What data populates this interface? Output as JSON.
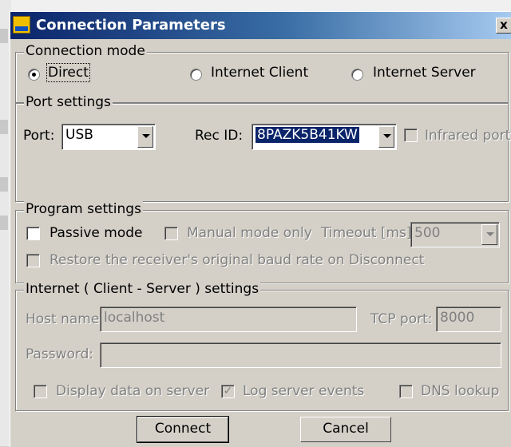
{
  "dialog": {
    "title": "Connection Parameters",
    "close_label": "x"
  },
  "connection_mode": {
    "legend": "Connection mode",
    "options": [
      {
        "label": "Direct",
        "selected": true
      },
      {
        "label": "Internet Client",
        "selected": false
      },
      {
        "label": "Internet Server",
        "selected": false
      }
    ]
  },
  "port_settings": {
    "legend": "Port settings",
    "port_label": "Port:",
    "port_value": "USB",
    "rec_id_label": "Rec ID:",
    "rec_id_value": "8PAZK5B41KW",
    "infrared_label": "Infrared port",
    "infrared_checked": false
  },
  "program_settings": {
    "legend": "Program settings",
    "passive_label": "Passive mode",
    "passive_checked": false,
    "manual_label": "Manual mode only",
    "manual_checked": false,
    "timeout_label": "Timeout [ms]:",
    "timeout_value": "500",
    "restore_label": "Restore the receiver's original baud rate on Disconnect",
    "restore_checked": false
  },
  "internet_settings": {
    "legend": "Internet ( Client - Server ) settings",
    "host_label": "Host name:",
    "host_value": "localhost",
    "tcp_label": "TCP port:",
    "tcp_value": "8000",
    "password_label": "Password:",
    "password_value": "",
    "display_label": "Display data on server",
    "display_checked": false,
    "log_label": "Log server events",
    "log_checked": true,
    "dns_label": "DNS lookup",
    "dns_checked": false
  },
  "buttons": {
    "connect": "Connect",
    "cancel": "Cancel"
  }
}
